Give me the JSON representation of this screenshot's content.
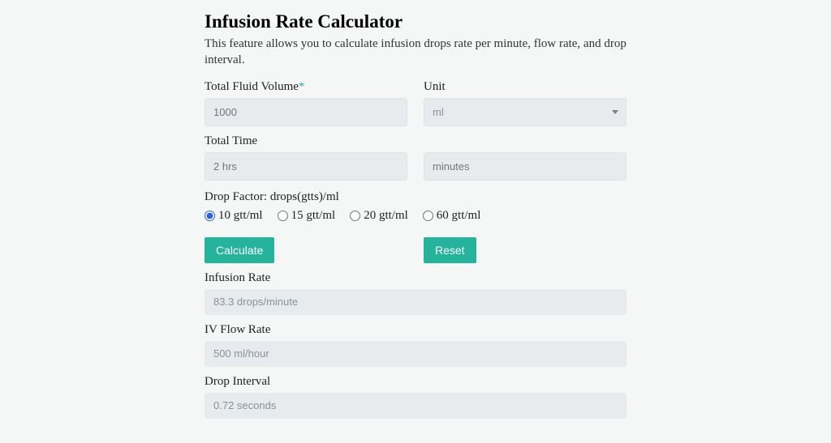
{
  "title": "Infusion Rate Calculator",
  "subtitle": "This feature allows you to calculate infusion drops rate per minute, flow rate, and drop interval.",
  "fields": {
    "volume": {
      "label": "Total Fluid Volume",
      "required": "*",
      "placeholder": "1000"
    },
    "unit": {
      "label": "Unit",
      "value": "ml"
    },
    "time": {
      "label": "Total Time",
      "placeholder": "2 hrs",
      "minutes_placeholder": "minutes"
    },
    "dropfactor": {
      "label": "Drop Factor: drops(gtts)/ml",
      "options": [
        {
          "label": "10 gtt/ml",
          "checked": true
        },
        {
          "label": "15 gtt/ml",
          "checked": false
        },
        {
          "label": "20 gtt/ml",
          "checked": false
        },
        {
          "label": "60 gtt/ml",
          "checked": false
        }
      ]
    }
  },
  "buttons": {
    "calculate": "Calculate",
    "reset": "Reset"
  },
  "results": {
    "infusion_rate": {
      "label": "Infusion Rate",
      "value": "83.3 drops/minute"
    },
    "flow_rate": {
      "label": "IV Flow Rate",
      "value": "500 ml/hour"
    },
    "drop_interval": {
      "label": "Drop Interval",
      "value": "0.72 seconds"
    }
  }
}
